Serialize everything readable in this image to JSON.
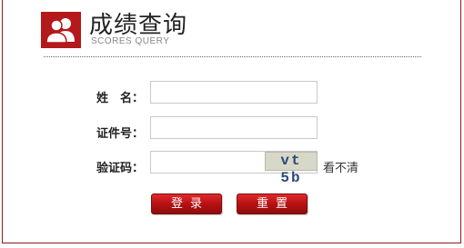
{
  "header": {
    "title": "成绩查询",
    "subtitle": "SCORES QUERY",
    "logo_icon": "users-icon"
  },
  "form": {
    "name_label": "姓　名：",
    "name_value": "",
    "id_label": "证件号：",
    "id_value": "",
    "captcha_label": "验证码：",
    "captcha_value": "",
    "captcha_text": "vt 5b",
    "refresh_label": "看不清"
  },
  "buttons": {
    "login_label": "登录",
    "reset_label": "重置"
  },
  "colors": {
    "accent": "#b4191b",
    "border": "#8b1a1a"
  }
}
